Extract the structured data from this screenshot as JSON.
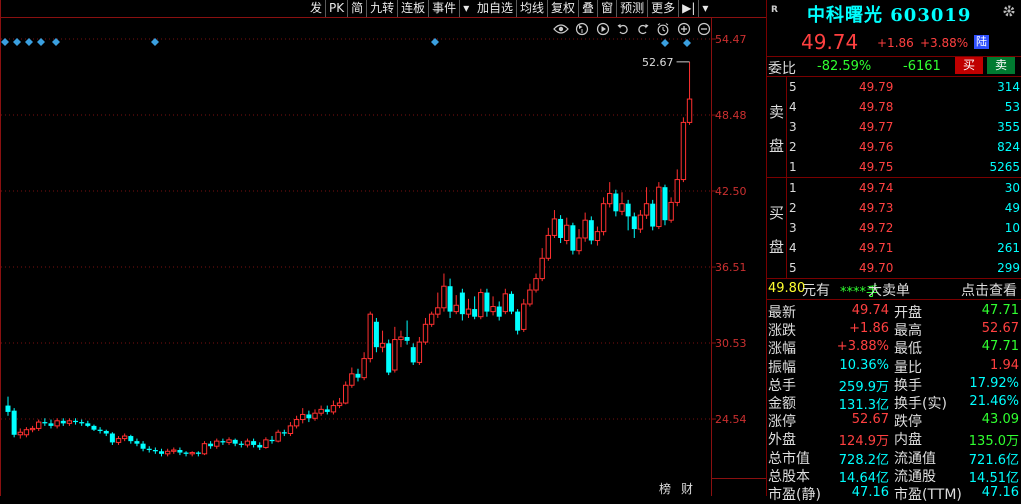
{
  "toolbar": {
    "items": [
      "发",
      "PK",
      "简",
      "九转",
      "连板",
      "事件",
      "加自选",
      "均线",
      "复权",
      "叠",
      "窗",
      "预测",
      "更多"
    ]
  },
  "chart_data": {
    "type": "candlestick",
    "title": "",
    "y_ticks": [
      "54.47",
      "48.48",
      "42.50",
      "36.51",
      "30.53",
      "24.54"
    ],
    "ylim": [
      21.55,
      54.47
    ],
    "high_label": "52.67",
    "grid": true,
    "up_color": "#ff3030",
    "down_color": "#00ffff",
    "candles": [
      {
        "o": 25.6,
        "c": 25.1,
        "h": 26.3,
        "l": 24.8
      },
      {
        "o": 25.2,
        "c": 23.3,
        "h": 25.4,
        "l": 23.1
      },
      {
        "o": 23.3,
        "c": 23.5,
        "h": 23.8,
        "l": 23.0
      },
      {
        "o": 23.3,
        "c": 23.7,
        "h": 23.9,
        "l": 23.1
      },
      {
        "o": 23.7,
        "c": 23.8,
        "h": 24.0,
        "l": 23.5
      },
      {
        "o": 23.8,
        "c": 24.3,
        "h": 24.5,
        "l": 23.6
      },
      {
        "o": 24.3,
        "c": 24.2,
        "h": 24.6,
        "l": 24.0
      },
      {
        "o": 24.2,
        "c": 24.0,
        "h": 24.5,
        "l": 23.8
      },
      {
        "o": 24.0,
        "c": 24.4,
        "h": 24.6,
        "l": 23.8
      },
      {
        "o": 24.4,
        "c": 24.2,
        "h": 24.6,
        "l": 24.0
      },
      {
        "o": 24.2,
        "c": 24.4,
        "h": 24.6,
        "l": 24.0
      },
      {
        "o": 24.4,
        "c": 24.3,
        "h": 24.6,
        "l": 24.1
      },
      {
        "o": 24.3,
        "c": 24.2,
        "h": 24.5,
        "l": 24.0
      },
      {
        "o": 24.2,
        "c": 24.0,
        "h": 24.4,
        "l": 23.9
      },
      {
        "o": 24.0,
        "c": 23.7,
        "h": 24.1,
        "l": 23.6
      },
      {
        "o": 23.7,
        "c": 23.6,
        "h": 23.9,
        "l": 23.4
      },
      {
        "o": 23.6,
        "c": 23.4,
        "h": 23.7,
        "l": 23.2
      },
      {
        "o": 23.4,
        "c": 22.7,
        "h": 23.5,
        "l": 22.5
      },
      {
        "o": 22.7,
        "c": 23.0,
        "h": 23.2,
        "l": 22.5
      },
      {
        "o": 23.0,
        "c": 23.2,
        "h": 23.4,
        "l": 22.8
      },
      {
        "o": 23.2,
        "c": 22.8,
        "h": 23.3,
        "l": 22.6
      },
      {
        "o": 22.8,
        "c": 22.6,
        "h": 23.0,
        "l": 22.4
      },
      {
        "o": 22.6,
        "c": 22.2,
        "h": 22.8,
        "l": 22.0
      },
      {
        "o": 22.2,
        "c": 22.1,
        "h": 22.4,
        "l": 21.9
      },
      {
        "o": 22.1,
        "c": 22.0,
        "h": 22.3,
        "l": 21.8
      },
      {
        "o": 22.0,
        "c": 21.8,
        "h": 22.2,
        "l": 21.6
      },
      {
        "o": 21.8,
        "c": 22.0,
        "h": 22.2,
        "l": 21.6
      },
      {
        "o": 22.0,
        "c": 22.1,
        "h": 22.3,
        "l": 21.8
      },
      {
        "o": 22.1,
        "c": 21.9,
        "h": 22.3,
        "l": 21.7
      },
      {
        "o": 21.9,
        "c": 21.8,
        "h": 22.0,
        "l": 21.6
      },
      {
        "o": 21.8,
        "c": 21.9,
        "h": 22.0,
        "l": 21.6
      },
      {
        "o": 21.9,
        "c": 21.8,
        "h": 22.0,
        "l": 21.6
      },
      {
        "o": 21.8,
        "c": 22.6,
        "h": 22.8,
        "l": 21.7
      },
      {
        "o": 22.6,
        "c": 22.4,
        "h": 22.8,
        "l": 22.2
      },
      {
        "o": 22.4,
        "c": 22.8,
        "h": 23.0,
        "l": 22.2
      },
      {
        "o": 22.8,
        "c": 22.7,
        "h": 23.0,
        "l": 22.5
      },
      {
        "o": 22.7,
        "c": 22.9,
        "h": 23.1,
        "l": 22.5
      },
      {
        "o": 22.9,
        "c": 22.6,
        "h": 23.0,
        "l": 22.4
      },
      {
        "o": 22.6,
        "c": 22.5,
        "h": 22.8,
        "l": 22.3
      },
      {
        "o": 22.5,
        "c": 22.8,
        "h": 23.0,
        "l": 22.3
      },
      {
        "o": 22.8,
        "c": 22.5,
        "h": 23.0,
        "l": 22.3
      },
      {
        "o": 22.5,
        "c": 22.3,
        "h": 22.7,
        "l": 22.1
      },
      {
        "o": 22.3,
        "c": 22.9,
        "h": 23.1,
        "l": 22.2
      },
      {
        "o": 22.9,
        "c": 22.8,
        "h": 23.2,
        "l": 22.6
      },
      {
        "o": 22.8,
        "c": 23.5,
        "h": 23.7,
        "l": 22.7
      },
      {
        "o": 23.5,
        "c": 23.4,
        "h": 23.7,
        "l": 23.2
      },
      {
        "o": 23.4,
        "c": 24.0,
        "h": 24.3,
        "l": 23.2
      },
      {
        "o": 24.0,
        "c": 24.5,
        "h": 24.8,
        "l": 23.8
      },
      {
        "o": 24.5,
        "c": 24.9,
        "h": 25.4,
        "l": 24.2
      },
      {
        "o": 24.9,
        "c": 24.6,
        "h": 25.2,
        "l": 24.3
      },
      {
        "o": 24.6,
        "c": 25.0,
        "h": 25.3,
        "l": 24.4
      },
      {
        "o": 25.0,
        "c": 25.3,
        "h": 25.6,
        "l": 24.8
      },
      {
        "o": 25.3,
        "c": 25.1,
        "h": 25.6,
        "l": 24.9
      },
      {
        "o": 25.1,
        "c": 25.6,
        "h": 26.0,
        "l": 24.9
      },
      {
        "o": 25.6,
        "c": 25.8,
        "h": 26.2,
        "l": 25.4
      },
      {
        "o": 25.8,
        "c": 27.2,
        "h": 27.5,
        "l": 25.7
      },
      {
        "o": 27.2,
        "c": 28.1,
        "h": 28.6,
        "l": 27.0
      },
      {
        "o": 28.1,
        "c": 27.8,
        "h": 28.5,
        "l": 27.5
      },
      {
        "o": 27.8,
        "c": 29.3,
        "h": 29.8,
        "l": 27.6
      },
      {
        "o": 29.3,
        "c": 32.8,
        "h": 33.0,
        "l": 29.0
      },
      {
        "o": 32.2,
        "c": 30.2,
        "h": 32.5,
        "l": 29.8
      },
      {
        "o": 30.2,
        "c": 30.5,
        "h": 31.5,
        "l": 29.8
      },
      {
        "o": 30.5,
        "c": 28.2,
        "h": 30.8,
        "l": 28.0
      },
      {
        "o": 28.4,
        "c": 30.8,
        "h": 31.8,
        "l": 28.2
      },
      {
        "o": 30.8,
        "c": 31.0,
        "h": 31.5,
        "l": 30.2
      },
      {
        "o": 31.0,
        "c": 30.7,
        "h": 32.3,
        "l": 30.4
      },
      {
        "o": 30.2,
        "c": 29.0,
        "h": 30.5,
        "l": 28.8
      },
      {
        "o": 29.0,
        "c": 30.6,
        "h": 31.0,
        "l": 28.8
      },
      {
        "o": 30.6,
        "c": 32.0,
        "h": 32.5,
        "l": 30.4
      },
      {
        "o": 32.0,
        "c": 32.8,
        "h": 33.0,
        "l": 31.8
      },
      {
        "o": 32.8,
        "c": 33.3,
        "h": 34.5,
        "l": 32.5
      },
      {
        "o": 33.3,
        "c": 35.0,
        "h": 36.0,
        "l": 33.0
      },
      {
        "o": 35.0,
        "c": 33.0,
        "h": 35.6,
        "l": 32.5
      },
      {
        "o": 33.0,
        "c": 33.5,
        "h": 34.3,
        "l": 32.8
      },
      {
        "o": 34.5,
        "c": 32.8,
        "h": 34.8,
        "l": 32.3
      },
      {
        "o": 32.8,
        "c": 33.2,
        "h": 34.0,
        "l": 32.5
      },
      {
        "o": 33.2,
        "c": 32.6,
        "h": 34.2,
        "l": 32.4
      },
      {
        "o": 32.6,
        "c": 34.5,
        "h": 34.8,
        "l": 32.4
      },
      {
        "o": 34.5,
        "c": 33.0,
        "h": 34.8,
        "l": 32.6
      },
      {
        "o": 33.0,
        "c": 33.4,
        "h": 34.2,
        "l": 32.7
      },
      {
        "o": 33.4,
        "c": 32.6,
        "h": 33.8,
        "l": 32.3
      },
      {
        "o": 33.0,
        "c": 34.4,
        "h": 34.8,
        "l": 32.8
      },
      {
        "o": 34.4,
        "c": 33.0,
        "h": 34.6,
        "l": 32.8
      },
      {
        "o": 33.0,
        "c": 31.5,
        "h": 33.2,
        "l": 31.2
      },
      {
        "o": 31.6,
        "c": 33.6,
        "h": 34.0,
        "l": 31.4
      },
      {
        "o": 33.6,
        "c": 34.7,
        "h": 35.2,
        "l": 33.4
      },
      {
        "o": 34.7,
        "c": 35.6,
        "h": 36.0,
        "l": 34.5
      },
      {
        "o": 35.6,
        "c": 37.2,
        "h": 38.0,
        "l": 35.4
      },
      {
        "o": 37.2,
        "c": 39.0,
        "h": 39.6,
        "l": 37.0
      },
      {
        "o": 39.0,
        "c": 40.3,
        "h": 41.0,
        "l": 38.8
      },
      {
        "o": 40.3,
        "c": 38.8,
        "h": 40.6,
        "l": 38.4
      },
      {
        "o": 38.6,
        "c": 39.8,
        "h": 40.4,
        "l": 38.3
      },
      {
        "o": 39.8,
        "c": 37.8,
        "h": 40.0,
        "l": 37.5
      },
      {
        "o": 37.8,
        "c": 38.8,
        "h": 39.5,
        "l": 37.5
      },
      {
        "o": 38.8,
        "c": 40.2,
        "h": 40.8,
        "l": 38.5
      },
      {
        "o": 40.2,
        "c": 38.6,
        "h": 40.5,
        "l": 38.3
      },
      {
        "o": 38.6,
        "c": 39.3,
        "h": 39.7,
        "l": 38.2
      },
      {
        "o": 39.3,
        "c": 41.5,
        "h": 42.0,
        "l": 39.0
      },
      {
        "o": 41.5,
        "c": 42.3,
        "h": 43.2,
        "l": 41.2
      },
      {
        "o": 42.3,
        "c": 40.9,
        "h": 42.6,
        "l": 40.5
      },
      {
        "o": 40.9,
        "c": 41.5,
        "h": 42.4,
        "l": 40.6
      },
      {
        "o": 41.5,
        "c": 40.5,
        "h": 41.8,
        "l": 39.4
      },
      {
        "o": 40.5,
        "c": 39.5,
        "h": 40.8,
        "l": 38.8
      },
      {
        "o": 39.5,
        "c": 40.6,
        "h": 41.0,
        "l": 39.2
      },
      {
        "o": 40.6,
        "c": 41.5,
        "h": 42.8,
        "l": 40.3
      },
      {
        "o": 41.5,
        "c": 39.7,
        "h": 41.8,
        "l": 39.4
      },
      {
        "o": 39.7,
        "c": 42.8,
        "h": 43.2,
        "l": 39.5
      },
      {
        "o": 42.8,
        "c": 40.2,
        "h": 43.0,
        "l": 39.8
      },
      {
        "o": 40.2,
        "c": 41.6,
        "h": 42.0,
        "l": 40.0
      },
      {
        "o": 41.6,
        "c": 43.4,
        "h": 44.2,
        "l": 41.3
      },
      {
        "o": 43.4,
        "c": 47.9,
        "h": 48.3,
        "l": 43.2
      },
      {
        "o": 47.9,
        "c": 49.74,
        "h": 52.67,
        "l": 47.71
      }
    ]
  },
  "signals": {
    "color": "#3aa0e0"
  },
  "panel": {
    "r_label": "R",
    "stock_name": "中科曙光 603019",
    "price": "49.74",
    "change": "+1.86",
    "change_pct": "+3.88%",
    "exchange_badge": "陆",
    "weibi": {
      "label": "委比",
      "pct": "-82.59%",
      "diff": "-6161",
      "buy": "买",
      "sell": "卖"
    },
    "sell_side": [
      "卖",
      "盘"
    ],
    "buy_side": [
      "买",
      "盘"
    ],
    "asks": [
      {
        "level": "5",
        "price": "49.79",
        "qty": "314"
      },
      {
        "level": "4",
        "price": "49.78",
        "qty": "53"
      },
      {
        "level": "3",
        "price": "49.77",
        "qty": "355"
      },
      {
        "level": "2",
        "price": "49.76",
        "qty": "824"
      },
      {
        "level": "1",
        "price": "49.75",
        "qty": "5265"
      }
    ],
    "bids": [
      {
        "level": "1",
        "price": "49.74",
        "qty": "30"
      },
      {
        "level": "2",
        "price": "49.73",
        "qty": "49"
      },
      {
        "level": "3",
        "price": "49.72",
        "qty": "10"
      },
      {
        "level": "4",
        "price": "49.71",
        "qty": "261"
      },
      {
        "level": "5",
        "price": "49.70",
        "qty": "299"
      }
    ],
    "big_order": {
      "price": "49.80",
      "unit_text": "元有",
      "hands": "****手",
      "type": "大卖单",
      "action": "点击查看"
    },
    "stats": [
      {
        "l1": "最新",
        "v1": "49.74",
        "c1": "#ff4040",
        "l2": "开盘",
        "v2": "47.71",
        "c2": "#30ff30"
      },
      {
        "l1": "涨跌",
        "v1": "+1.86",
        "c1": "#ff4040",
        "l2": "最高",
        "v2": "52.67",
        "c2": "#ff4040"
      },
      {
        "l1": "涨幅",
        "v1": "+3.88%",
        "c1": "#ff4040",
        "l2": "最低",
        "v2": "47.71",
        "c2": "#30ff30"
      },
      {
        "l1": "振幅",
        "v1": "10.36%",
        "c1": "#00ffff",
        "l2": "量比",
        "v2": "1.94",
        "c2": "#ff4040"
      },
      {
        "l1": "总手",
        "v1": "259.9万",
        "c1": "#00ffff",
        "l2": "换手",
        "v2": "17.92%",
        "c2": "#00ffff"
      },
      {
        "l1": "金额",
        "v1": "131.3亿",
        "c1": "#00ffff",
        "l2": "换手(实)",
        "v2": "21.46%",
        "c2": "#00ffff"
      },
      {
        "l1": "涨停",
        "v1": "52.67",
        "c1": "#ff4040",
        "l2": "跌停",
        "v2": "43.09",
        "c2": "#30ff30"
      },
      {
        "l1": "外盘",
        "v1": "124.9万",
        "c1": "#ff4040",
        "l2": "内盘",
        "v2": "135.0万",
        "c2": "#30ff30"
      },
      {
        "l1": "总市值",
        "v1": "728.2亿",
        "c1": "#00ffff",
        "l2": "流通值",
        "v2": "721.6亿",
        "c2": "#00ffff"
      },
      {
        "l1": "总股本",
        "v1": "14.64亿",
        "c1": "#00ffff",
        "l2": "流通股",
        "v2": "14.51亿",
        "c2": "#00ffff"
      },
      {
        "l1": "市盈(静)",
        "v1": "47.16",
        "c1": "#00ffff",
        "l2": "市盈(TTM)",
        "v2": "47.16",
        "c2": "#00ffff"
      }
    ]
  },
  "footer": {
    "bang": "榜",
    "cai": "财"
  }
}
